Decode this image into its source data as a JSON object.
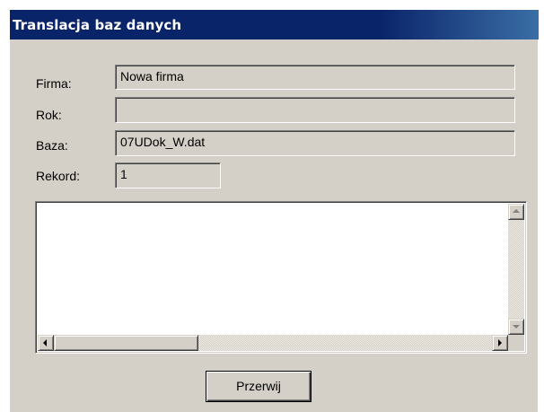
{
  "window": {
    "title": "Translacja baz danych"
  },
  "form": {
    "firma_label": "Firma:",
    "firma_value": "Nowa firma",
    "rok_label": "Rok:",
    "rok_value": "",
    "baza_label": "Baza:",
    "baza_value": "07UDok_W.dat",
    "rekord_label": "Rekord:",
    "rekord_value": "1"
  },
  "log": {
    "content": ""
  },
  "buttons": {
    "przerwij_label": "Przerwij"
  },
  "icons": {
    "scroll_up": "arrow-up-icon",
    "scroll_down": "arrow-down-icon",
    "scroll_left": "arrow-left-icon",
    "scroll_right": "arrow-right-icon"
  },
  "colors": {
    "titlebar": "#0a246a",
    "face": "#d4d0c8"
  }
}
